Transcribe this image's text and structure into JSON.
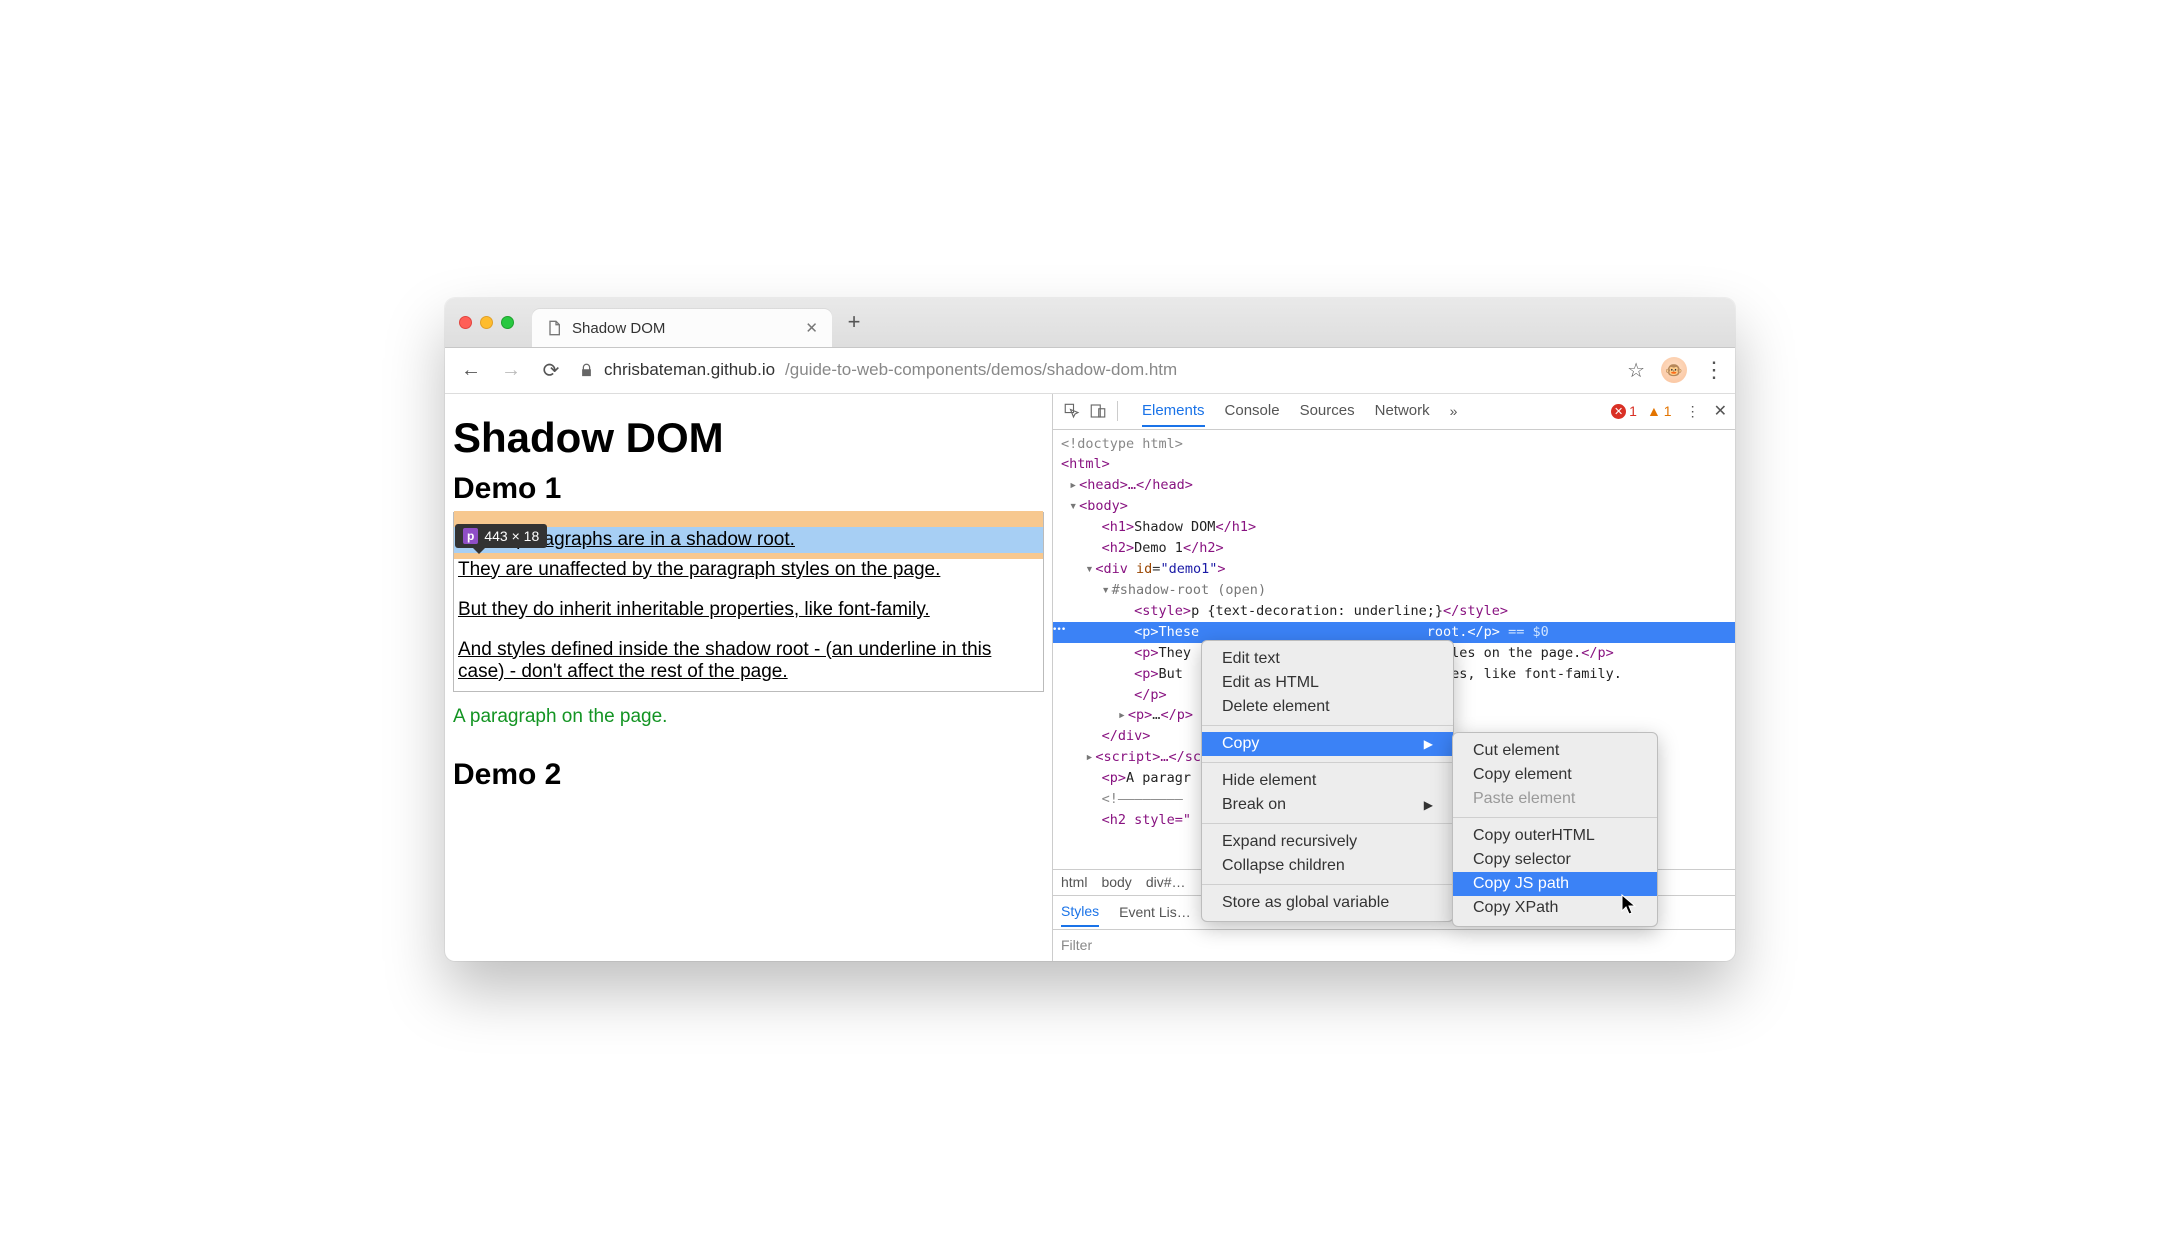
{
  "tab": {
    "title": "Shadow DOM"
  },
  "url": {
    "host": "chrisbateman.github.io",
    "path": "/guide-to-web-components/demos/shadow-dom.htm"
  },
  "tooltip": {
    "tag": "p",
    "dims": "443 × 18"
  },
  "page": {
    "h1": "Shadow DOM",
    "h2a": "Demo 1",
    "p1": "These paragraphs are in a shadow root.",
    "p2": "They are unaffected by the paragraph styles on the page.",
    "p3": "But they do inherit inheritable properties, like font-family.",
    "p4": "And styles defined inside the shadow root - (an underline in this case) - don't affect the rest of the page.",
    "outside": "A paragraph on the page.",
    "h2b": "Demo 2"
  },
  "devtools": {
    "tabs": [
      "Elements",
      "Console",
      "Sources",
      "Network"
    ],
    "errors": "1",
    "warns": "1",
    "dom": {
      "doctype": "<!doctype html>",
      "html_open": "<html>",
      "head": "<head>…</head>",
      "body_open": "<body>",
      "h1": "Shadow DOM",
      "h2": "Demo 1",
      "div_attr": "demo1",
      "shadow": "#shadow-root (open)",
      "style_txt": "p {text-decoration: underline;}",
      "p_sel_pre": "These",
      "p_sel_post": "root.",
      "sel_suffix": "== $0",
      "p2a": "They",
      "p2b": "aph styles on the page.",
      "p3a": "But ",
      "p3b": "roperties, like font-family.",
      "script": "<script>…</scr",
      "outside": "A paragr",
      "h2b": "<h2 style=\""
    },
    "breadcrumb": [
      "html",
      "body",
      "div#…"
    ],
    "subtabs": [
      "Styles",
      "Event Lis…"
    ],
    "filter": "Filter"
  },
  "ctx": {
    "items1": [
      "Edit text",
      "Edit as HTML",
      "Delete element"
    ],
    "copy": "Copy",
    "items2": [
      "Hide element",
      "Break on"
    ],
    "items3": [
      "Expand recursively",
      "Collapse children"
    ],
    "items4": [
      "Store as global variable"
    ]
  },
  "sub": {
    "g1": [
      "Cut element",
      "Copy element",
      "Paste element"
    ],
    "g2": [
      "Copy outerHTML",
      "Copy selector",
      "Copy JS path",
      "Copy XPath"
    ]
  }
}
